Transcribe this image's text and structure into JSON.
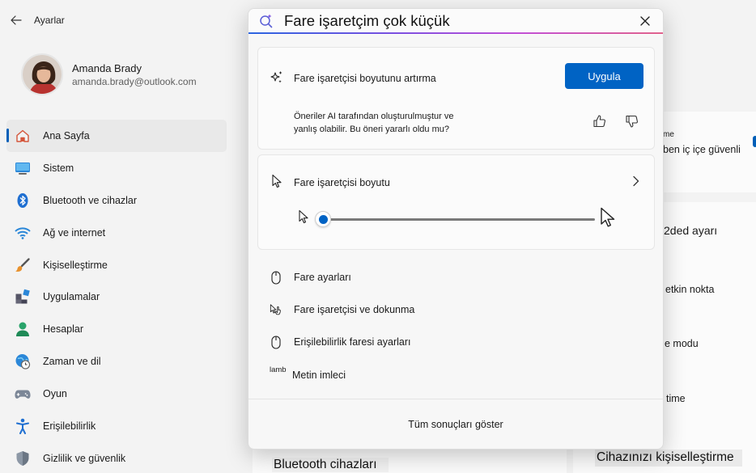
{
  "app": {
    "title": "Ayarlar"
  },
  "profile": {
    "name": "Amanda Brady",
    "email": "amanda.brady@outlook.com"
  },
  "nav": {
    "items": [
      {
        "label": "Ana Sayfa",
        "icon": "home-icon",
        "active": true
      },
      {
        "label": "Sistem",
        "icon": "monitor-icon"
      },
      {
        "label": "Bluetooth ve cihazlar",
        "icon": "bluetooth-icon"
      },
      {
        "label": "Ağ ve internet",
        "icon": "wifi-icon"
      },
      {
        "label": "Kişiselleştirme",
        "icon": "brush-icon"
      },
      {
        "label": "Uygulamalar",
        "icon": "apps-icon"
      },
      {
        "label": "Hesaplar",
        "icon": "person-icon"
      },
      {
        "label": "Zaman ve dil",
        "icon": "globe-clock-icon"
      },
      {
        "label": "Oyun",
        "icon": "gamepad-icon"
      },
      {
        "label": "Erişilebilirlik",
        "icon": "accessibility-icon"
      },
      {
        "label": "Gizlilik ve güvenlik",
        "icon": "shield-icon"
      }
    ]
  },
  "right_panel": {
    "line_me": "me",
    "line_secure": "ben iç içe güvenli",
    "line_2ded": "2ded ayarı",
    "line_hotspot": "etkin nokta",
    "line_mode": "e modu",
    "line_time": "time"
  },
  "bottom": {
    "left_title": "Bluetooth cihazları",
    "right_title": "Cihazınızı kişiselleştirme"
  },
  "search": {
    "query": "Fare işaretçim çok küçük",
    "icon": "copilot-search-icon"
  },
  "ai_card": {
    "title": "Fare işaretçisi boyutunu artırma",
    "apply_label": "Uygula",
    "note": "Öneriler AI tarafından oluşturulmuştur ve yanlış olabilir. Bu öneri yararlı oldu mu?"
  },
  "size_card": {
    "title": "Fare işaretçisi boyutu",
    "slider_value": 0.0
  },
  "results": [
    {
      "label": "Fare ayarları",
      "icon": "mouse-icon"
    },
    {
      "label": "Fare işaretçisi ve dokunma",
      "icon": "pointer-touch-icon"
    },
    {
      "label": "Erişilebilirlik faresi ayarları",
      "icon": "mouse-icon"
    },
    {
      "label": "Metin imleci",
      "icon_text": "lamb"
    }
  ],
  "footer": {
    "show_all_label": "Tüm sonuçları göster"
  },
  "colors": {
    "accent": "#0063c4",
    "nav_indicator": "#005fb8"
  }
}
